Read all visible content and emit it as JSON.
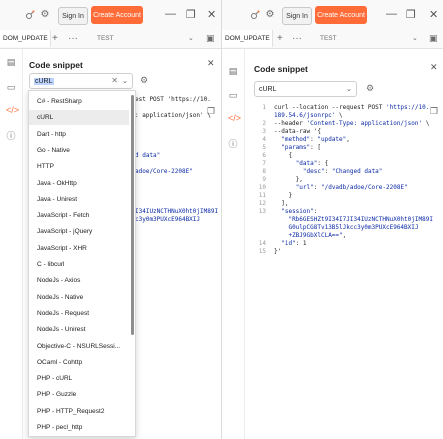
{
  "left": {
    "header": {
      "signin": "Sign In",
      "create_account": "Create Account"
    },
    "tabs": {
      "active": "DOM_UPDATE",
      "env": "TEST"
    },
    "panel": {
      "title": "Code snippet",
      "lang_value": "cURL"
    },
    "code_lines": [
      {
        "t": "est POST 'https://10."
      },
      {
        "t": ""
      },
      {
        "t": ": application/json' \\"
      },
      {
        "t": ""
      },
      {
        "t": ""
      },
      {
        "t": ""
      },
      {
        "t": ""
      },
      {
        "t": "d data\""
      },
      {
        "t": ""
      },
      {
        "t": "adoe/Core-2208E\""
      },
      {
        "t": ""
      },
      {
        "t": ""
      },
      {
        "t": ""
      },
      {
        "t": ""
      },
      {
        "t": "I34IUzNCTHNuX0ht0jIM89I"
      },
      {
        "t": "c3y0m3PUXcE964BXIJ"
      }
    ],
    "dropdown_items": [
      "C# - RestSharp",
      "cURL",
      "Dart - http",
      "Go - Native",
      "HTTP",
      "Java - OkHttp",
      "Java - Unirest",
      "JavaScript - Fetch",
      "JavaScript - jQuery",
      "JavaScript - XHR",
      "C - libcurl",
      "NodeJs - Axios",
      "NodeJs - Native",
      "NodeJs - Request",
      "NodeJs - Unirest",
      "Objective-C - NSURLSessi...",
      "OCaml - Cohttp",
      "PHP - cURL",
      "PHP - Guzzle",
      "PHP - HTTP_Request2",
      "PHP - pecl_http"
    ],
    "dropdown_selected": 1
  },
  "right": {
    "header": {
      "signin": "Sign In",
      "create_account": "Create Account"
    },
    "tabs": {
      "active": "DOM_UPDATE",
      "env": "TEST"
    },
    "panel": {
      "title": "Code snippet",
      "lang_value": "cURL"
    },
    "code": [
      {
        "n": "1",
        "a": "curl --location --request POST ",
        "s": "'https://10."
      },
      {
        "n": "",
        "a": "",
        "s": "189.54.6/jsonrpc'",
        "b": " \\"
      },
      {
        "n": "2",
        "a": "--header ",
        "s": "'Content-Type: application/json'",
        "b": " \\"
      },
      {
        "n": "3",
        "a": "--data-raw '{"
      },
      {
        "n": "4",
        "a": "  ",
        "s": "\"method\"",
        "b": ": ",
        "s2": "\"update\"",
        "c": ","
      },
      {
        "n": "5",
        "a": "  ",
        "s": "\"params\"",
        "b": ": ["
      },
      {
        "n": "6",
        "a": "    {"
      },
      {
        "n": "7",
        "a": "      ",
        "s": "\"data\"",
        "b": ": {"
      },
      {
        "n": "8",
        "a": "        ",
        "s": "\"desc\"",
        "b": ": ",
        "s2": "\"Changed data\""
      },
      {
        "n": "9",
        "a": "      },"
      },
      {
        "n": "10",
        "a": "      ",
        "s": "\"url\"",
        "b": ": ",
        "s2": "\"/dvadb/adoe/Core-2208E\""
      },
      {
        "n": "11",
        "a": "    }"
      },
      {
        "n": "12",
        "a": "  ],"
      },
      {
        "n": "13",
        "a": "  ",
        "s": "\"session\"",
        "b": ":"
      },
      {
        "n": "",
        "a": "    ",
        "s": "\"Rb6GESHZt9I34I7JI34IUzNCTHNuX0ht0jIM89I"
      },
      {
        "n": "",
        "a": "    ",
        "s": "G0ulpCG8Tv13B5lJkcc3y0m3PUXcE964BXIJ"
      },
      {
        "n": "",
        "a": "    ",
        "s": "+ZBJ9GbXlCLA==\"",
        "c": ","
      },
      {
        "n": "14",
        "a": "  ",
        "s": "\"id\"",
        "b": ": 1"
      },
      {
        "n": "15",
        "a": "}'"
      }
    ]
  }
}
